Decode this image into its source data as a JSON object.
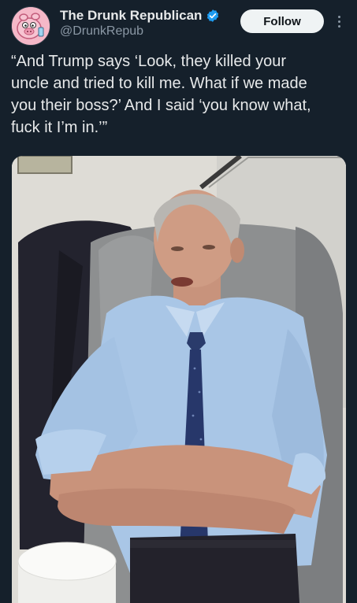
{
  "account": {
    "display_name": "The Drunk Republican",
    "handle": "@DrunkRepub",
    "verified": true,
    "avatar_icon": "pink-pig-avatar-icon"
  },
  "actions": {
    "follow_label": "Follow",
    "more_icon": "more-vertical-icon"
  },
  "tweet": {
    "text": "“And Trump says ‘Look, they killed your\nuncle and tried to kill me. What if we made\nyou their boss?’ And I said ‘you know what,\nfuck it I’m in.’”"
  },
  "colors": {
    "background": "#15202b",
    "verified_badge": "#1d9bf0",
    "follow_button_bg": "#eff3f4"
  }
}
